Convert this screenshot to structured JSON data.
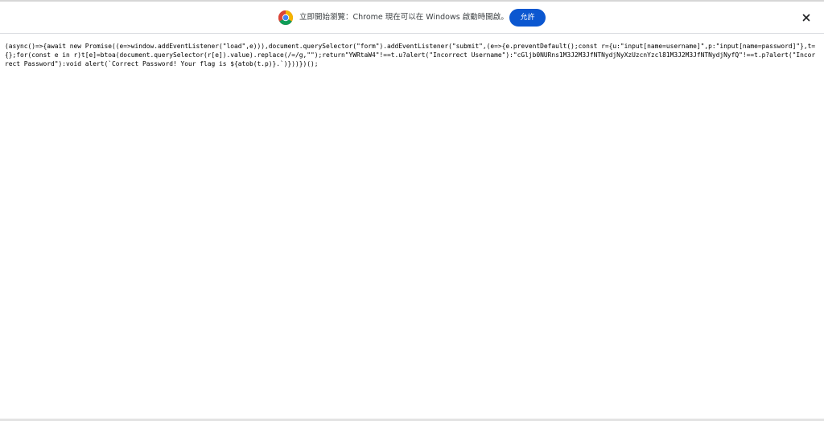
{
  "infobar": {
    "message": "立即開始瀏覽：Chrome 現在可以在 Windows 啟動時開啟。",
    "allow_label": "允許",
    "icon": "chrome-logo-icon",
    "close_icon": "close-icon",
    "accent_color": "#0b57d0"
  },
  "page": {
    "source_code": "(async()=>{await new Promise((e=>window.addEventListener(\"load\",e))),document.querySelector(\"form\").addEventListener(\"submit\",(e=>{e.preventDefault();const r={u:\"input[name=username]\",p:\"input[name=password]\"},t={};for(const e in r)t[e]=btoa(document.querySelector(r[e]).value).replace(/=/g,\"\");return\"YWRtaW4\"!==t.u?alert(\"Incorrect Username\"):\"cGljb0NURns1M3J2M3JfNTNydjNyXzUzcnYzcl81M3J2M3JfNTNydjNyfQ\"!==t.p?alert(\"Incorrect Password\"):void alert(`Correct Password! Your flag is ${atob(t.p)}.`)}))})();"
  }
}
